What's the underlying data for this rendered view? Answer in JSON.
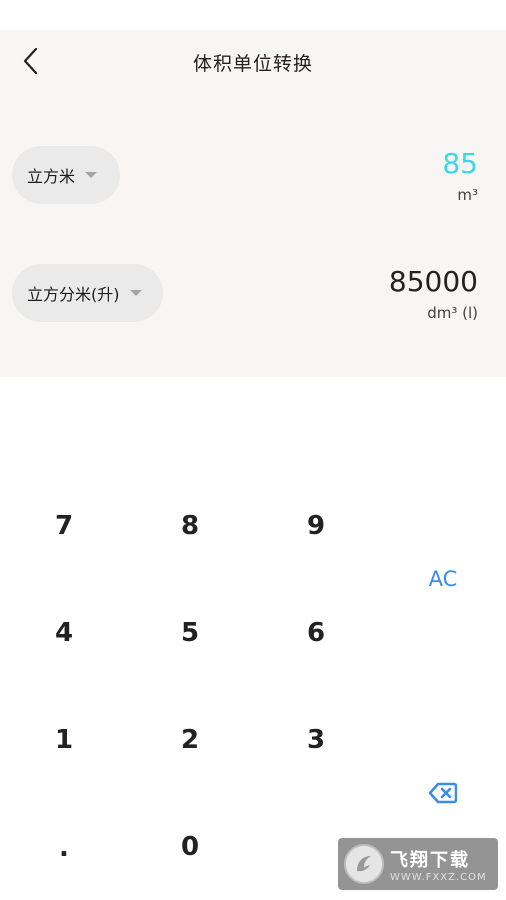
{
  "header": {
    "title": "体积单位转换",
    "back_icon": "chevron-left-icon"
  },
  "converter": {
    "from": {
      "unit_label": "立方米",
      "value": "85",
      "symbol": "m³",
      "value_color": "#3bd8e6"
    },
    "to": {
      "unit_label": "立方分米(升)",
      "value": "85000",
      "symbol": "dm³ (l)",
      "value_color": "#222222"
    }
  },
  "keypad": {
    "keys": [
      "7",
      "8",
      "9",
      "4",
      "5",
      "6",
      "1",
      "2",
      "3",
      ".",
      "0"
    ],
    "clear_label": "AC",
    "delete_icon": "backspace-icon",
    "accent_color": "#3a8ee6"
  },
  "watermark": {
    "main": "飞翔下载",
    "sub": "WWW.FXXZ.COM"
  }
}
